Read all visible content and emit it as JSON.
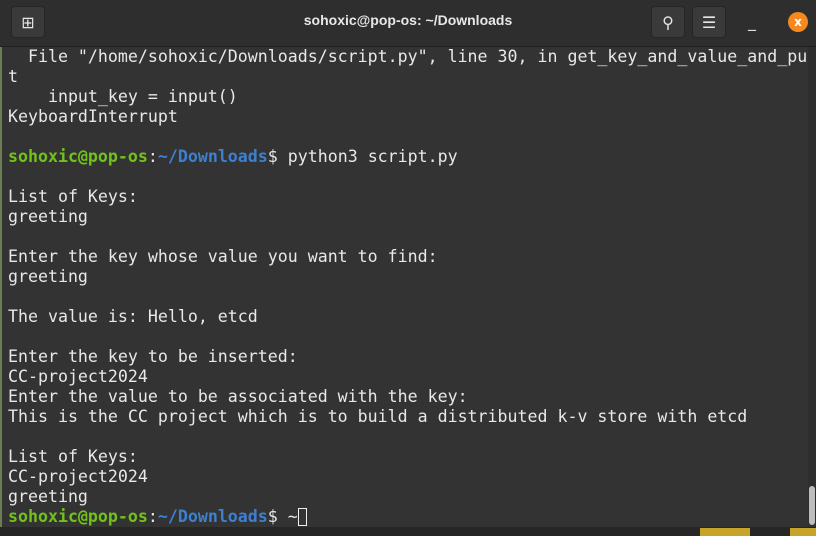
{
  "window": {
    "title": "sohoxic@pop-os: ~/Downloads",
    "icons": {
      "new_tab": "new-tab-icon",
      "search": "search-icon",
      "menu": "hamburger-menu-icon",
      "minimize": "minimize-icon",
      "close": "close-icon"
    },
    "accent_color": "#f5891f"
  },
  "prompt": {
    "user_host": "sohoxic@pop-os",
    "sep": ":",
    "path": "~/Downloads",
    "dollar": "$ "
  },
  "lines": [
    {
      "text": "  File \"/home/sohoxic/Downloads/script.py\", line 30, in get_key_and_value_and_pu"
    },
    {
      "text": "t"
    },
    {
      "text": "    input_key = input()"
    },
    {
      "text": "KeyboardInterrupt"
    },
    {
      "text": ""
    },
    {
      "prompt": true,
      "cmd": "python3 script.py"
    },
    {
      "text": ""
    },
    {
      "text": "List of Keys:"
    },
    {
      "text": "greeting"
    },
    {
      "text": ""
    },
    {
      "text": "Enter the key whose value you want to find:"
    },
    {
      "text": "greeting"
    },
    {
      "text": ""
    },
    {
      "text": "The value is: Hello, etcd"
    },
    {
      "text": ""
    },
    {
      "text": "Enter the key to be inserted:"
    },
    {
      "text": "CC-project2024"
    },
    {
      "text": "Enter the value to be associated with the key:"
    },
    {
      "text": "This is the CC project which is to build a distributed k-v store with etcd"
    },
    {
      "text": ""
    },
    {
      "text": "List of Keys:"
    },
    {
      "text": "CC-project2024"
    },
    {
      "text": "greeting"
    },
    {
      "prompt": true,
      "cmd": "~",
      "cursor": true
    }
  ]
}
